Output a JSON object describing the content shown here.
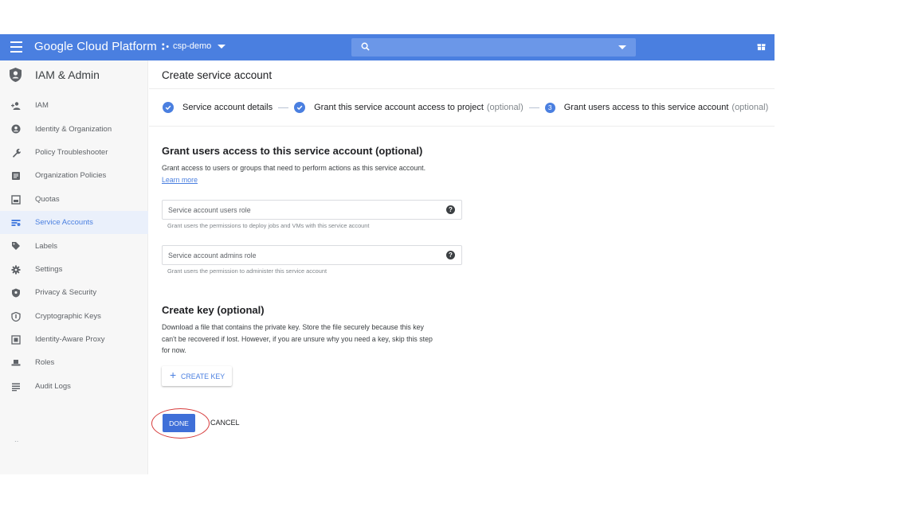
{
  "topbar": {
    "brand": "Google Cloud Platform",
    "project": "csp-demo"
  },
  "sidebar": {
    "title": "IAM & Admin",
    "items": [
      {
        "label": "IAM",
        "icon": "person-add-icon"
      },
      {
        "label": "Identity & Organization",
        "icon": "account-circle-icon"
      },
      {
        "label": "Policy Troubleshooter",
        "icon": "wrench-icon"
      },
      {
        "label": "Organization Policies",
        "icon": "document-icon"
      },
      {
        "label": "Quotas",
        "icon": "quota-icon"
      },
      {
        "label": "Service Accounts",
        "icon": "service-account-icon"
      },
      {
        "label": "Labels",
        "icon": "label-icon"
      },
      {
        "label": "Settings",
        "icon": "gear-icon"
      },
      {
        "label": "Privacy & Security",
        "icon": "privacy-shield-icon"
      },
      {
        "label": "Cryptographic Keys",
        "icon": "key-shield-icon"
      },
      {
        "label": "Identity-Aware Proxy",
        "icon": "proxy-icon"
      },
      {
        "label": "Roles",
        "icon": "hat-icon"
      },
      {
        "label": "Audit Logs",
        "icon": "list-icon"
      }
    ],
    "active": "Service Accounts"
  },
  "main": {
    "title": "Create service account",
    "steps": [
      {
        "label": "Service account details",
        "optional": "",
        "state": "done"
      },
      {
        "label": "Grant this service account access to project",
        "optional": "(optional)",
        "state": "done"
      },
      {
        "number": "3",
        "label": "Grant users access to this service account",
        "optional": "(optional)",
        "state": "current"
      }
    ],
    "grant_section": {
      "heading": "Grant users access to this service account (optional)",
      "desc": "Grant access to users or groups that need to perform actions as this service account.",
      "learn_more": "Learn more",
      "users_role_label": "Service account users role",
      "users_role_hint": "Grant users the permissions to deploy jobs and VMs with this service account",
      "admins_role_label": "Service account admins role",
      "admins_role_hint": "Grant users the permission to administer this service account"
    },
    "key_section": {
      "heading": "Create key (optional)",
      "desc_lines": [
        "Download a file that contains the private key. Store the file securely because this key",
        "can't be recovered if lost. However, if you are unsure why you need a key, skip this step",
        "for now."
      ],
      "create_key": "CREATE KEY"
    },
    "done": "DONE",
    "cancel": "CANCEL"
  },
  "colors": {
    "topbar": "#4a7fe0",
    "accent": "#4a7fe0",
    "highlight_ring": "#d63a3a"
  }
}
